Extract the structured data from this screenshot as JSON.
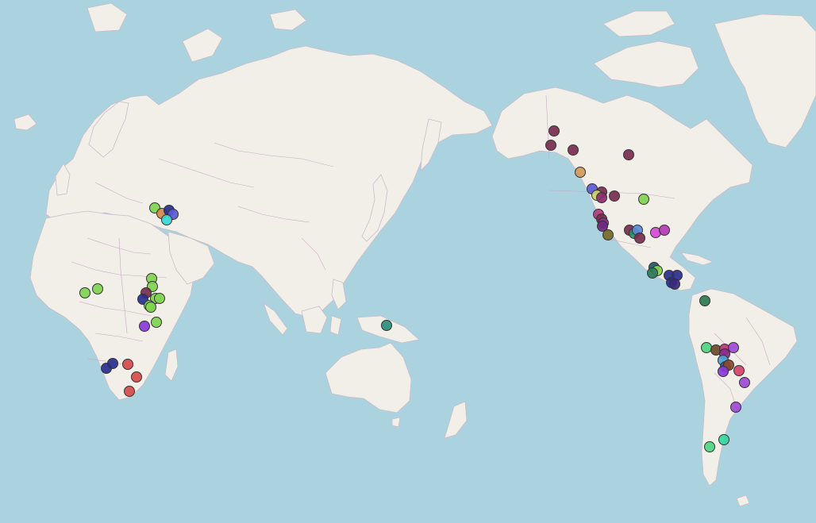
{
  "map": {
    "projection": "pacific-centered",
    "ocean_color": "#aad3df",
    "land_color": "#f2efe9",
    "border_color": "#c7a9c2",
    "marker_stroke": "#333333"
  },
  "markers": [
    {
      "region": "alaska",
      "color": "#7a2e4f"
    },
    {
      "region": "alaska",
      "color": "#7a2e4f"
    },
    {
      "region": "yukon",
      "color": "#7a2e4f"
    },
    {
      "region": "nwt",
      "color": "#7a2e4f"
    },
    {
      "region": "bc",
      "color": "#d09a5a"
    },
    {
      "region": "pnw",
      "color": "#5a5ad6"
    },
    {
      "region": "pnw",
      "color": "#7a2e4f"
    },
    {
      "region": "pnw",
      "color": "#c9d16a"
    },
    {
      "region": "pnw",
      "color": "#8a2e6e"
    },
    {
      "region": "montana",
      "color": "#7a2e4f"
    },
    {
      "region": "dakota",
      "color": "#7fd44f"
    },
    {
      "region": "california",
      "color": "#b43a7a"
    },
    {
      "region": "california",
      "color": "#7a2e4f"
    },
    {
      "region": "california",
      "color": "#8a2e8e"
    },
    {
      "region": "california",
      "color": "#6e2a7e"
    },
    {
      "region": "baja",
      "color": "#7a6a2a"
    },
    {
      "region": "southwest",
      "color": "#7a2e4f"
    },
    {
      "region": "southwest",
      "color": "#2e8e6e"
    },
    {
      "region": "southwest",
      "color": "#5a8ad6"
    },
    {
      "region": "southwest",
      "color": "#7a2e4f"
    },
    {
      "region": "southeast",
      "color": "#d64ad6"
    },
    {
      "region": "southeast",
      "color": "#b43ab4"
    },
    {
      "region": "mexico",
      "color": "#1e5a6e"
    },
    {
      "region": "mexico",
      "color": "#7fd44f"
    },
    {
      "region": "mexico",
      "color": "#2e7a5a"
    },
    {
      "region": "central-america",
      "color": "#2a2e8e"
    },
    {
      "region": "central-america",
      "color": "#2a2e8e"
    },
    {
      "region": "central-america",
      "color": "#2a2e8e"
    },
    {
      "region": "central-america",
      "color": "#3a2a7e"
    },
    {
      "region": "colombia",
      "color": "#2e7a4f"
    },
    {
      "region": "peru",
      "color": "#4fd47f"
    },
    {
      "region": "peru",
      "color": "#6a4a2a"
    },
    {
      "region": "peru",
      "color": "#b43a7a"
    },
    {
      "region": "bolivia",
      "color": "#a04ad6"
    },
    {
      "region": "bolivia",
      "color": "#8a2e8e"
    },
    {
      "region": "bolivia",
      "color": "#4fa0d6"
    },
    {
      "region": "bolivia",
      "color": "#2e5a8e"
    },
    {
      "region": "bolivia",
      "color": "#8a4a2a"
    },
    {
      "region": "bolivia",
      "color": "#d6406a"
    },
    {
      "region": "bolivia",
      "color": "#8a3ad6"
    },
    {
      "region": "argentina",
      "color": "#a04ad6"
    },
    {
      "region": "argentina",
      "color": "#a04ad6"
    },
    {
      "region": "patagonia",
      "color": "#3ad6a0"
    },
    {
      "region": "patagonia",
      "color": "#4fd47f"
    },
    {
      "region": "caucasus",
      "color": "#7fd44f"
    },
    {
      "region": "caucasus",
      "color": "#d08a4a"
    },
    {
      "region": "caucasus",
      "color": "#2a2e8e"
    },
    {
      "region": "caucasus",
      "color": "#5a5ad6"
    },
    {
      "region": "caucasus",
      "color": "#3ad6d6"
    },
    {
      "region": "west-africa",
      "color": "#7fd44f"
    },
    {
      "region": "west-africa",
      "color": "#7fd44f"
    },
    {
      "region": "east-africa",
      "color": "#7fd44f"
    },
    {
      "region": "east-africa",
      "color": "#7fd44f"
    },
    {
      "region": "east-africa",
      "color": "#7a2e4f"
    },
    {
      "region": "east-africa",
      "color": "#2a2e8e"
    },
    {
      "region": "east-africa",
      "color": "#7fd44f"
    },
    {
      "region": "east-africa",
      "color": "#7fd44f"
    },
    {
      "region": "east-africa",
      "color": "#7fd44f"
    },
    {
      "region": "east-africa",
      "color": "#7fd44f"
    },
    {
      "region": "tanzania",
      "color": "#8a3ad6"
    },
    {
      "region": "tanzania",
      "color": "#7fd44f"
    },
    {
      "region": "namibia",
      "color": "#2a2e8e"
    },
    {
      "region": "namibia",
      "color": "#2a2e8e"
    },
    {
      "region": "south-africa",
      "color": "#d64a4a"
    },
    {
      "region": "south-africa",
      "color": "#d64a4a"
    },
    {
      "region": "south-africa",
      "color": "#d64a4a"
    },
    {
      "region": "new-guinea",
      "color": "#2e8e7a"
    }
  ]
}
